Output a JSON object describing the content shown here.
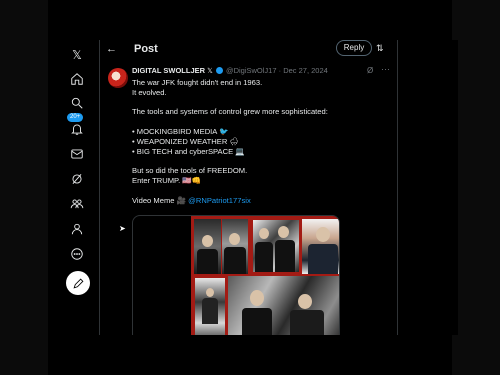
{
  "nav": {
    "items": [
      {
        "name": "x-logo-icon",
        "glyph": "𝕏"
      },
      {
        "name": "home-icon"
      },
      {
        "name": "search-icon"
      },
      {
        "name": "notifications-icon",
        "badge": "20+"
      },
      {
        "name": "messages-icon"
      },
      {
        "name": "grok-icon"
      },
      {
        "name": "communities-icon"
      },
      {
        "name": "profile-icon"
      },
      {
        "name": "more-icon"
      }
    ],
    "compose": "compose-post-icon"
  },
  "header": {
    "back": "←",
    "title": "Post",
    "reply_label": "Reply",
    "filter": "⇅"
  },
  "tweet": {
    "author_name": "DIGITAL SWOLLJER",
    "author_suffix": "𝕏",
    "handle_date": "@DigiSwOlJ17 · Dec 27, 2024",
    "grok": "Ø",
    "more": "···",
    "lines": {
      "l1": "The war JFK fought didn't end in 1963.",
      "l2": "It evolved.",
      "l3": "The tools and systems of control grew more sophisticated:",
      "l4": "• MOCKINGBIRD MEDIA 🐦",
      "l5": "• WEAPONIZED WEATHER 🌧",
      "l6": "• BIG TECH and cyberSPACE 💻",
      "l7": "But so did the tools of FREEDOM.",
      "l8": "Enter TRUMP. 🇺🇸👊",
      "l9_prefix": "Video Meme 🎥 ",
      "l9_link": "@RNPatriot177six"
    }
  },
  "colors": {
    "accent": "#1d9bf0",
    "background": "#000000",
    "collage_border": "#a31b14"
  }
}
